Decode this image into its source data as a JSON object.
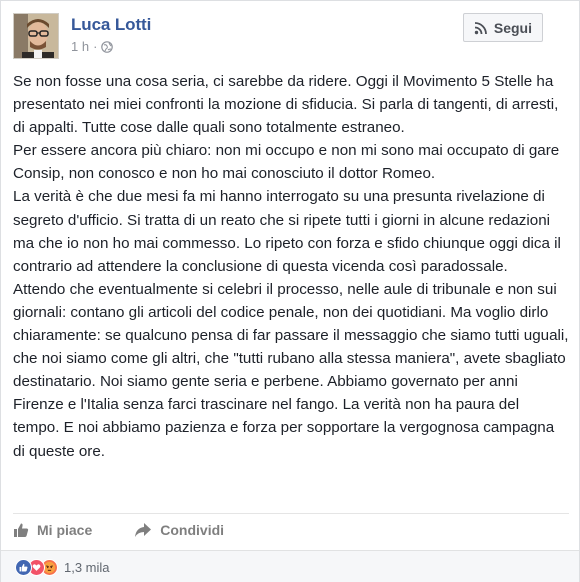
{
  "post": {
    "author": "Luca Lotti",
    "time": "1 h",
    "dot": "·",
    "follow_label": "Segui",
    "paragraphs": [
      "Se non fosse una cosa seria, ci sarebbe da ridere. Oggi il Movimento 5 Stelle ha presentato nei miei confronti la mozione di sfiducia. Si parla di tangenti, di arresti, di appalti. Tutte cose dalle quali sono totalmente estraneo.",
      "Per essere ancora più chiaro: non mi occupo e non mi sono mai occupato di gare Consip, non conosco e non ho mai conosciuto il dottor Romeo.",
      "La verità è che due mesi fa mi hanno interrogato su una presunta rivelazione di segreto d'ufficio. Si tratta di un reato che si ripete tutti i giorni in alcune redazioni ma che io non ho mai commesso. Lo ripeto con forza e sfido chiunque oggi dica il contrario ad attendere la conclusione di questa vicenda così paradossale.",
      "Attendo che eventualmente si celebri il processo, nelle aule di tribunale e non sui giornali: contano gli articoli del codice penale, non dei quotidiani. Ma voglio dirlo chiaramente: se qualcuno pensa di far passare il messaggio che siamo tutti uguali, che noi siamo come gli altri, che \"tutti rubano alla stessa maniera\", avete sbagliato destinatario. Noi siamo gente seria e perbene. Abbiamo governato per anni Firenze e l'Italia senza farci trascinare nel fango. La verità non ha paura del tempo. E noi abbiamo pazienza e forza per sopportare la vergognosa campagna di queste ore."
    ]
  },
  "actions": {
    "like_label": "Mi piace",
    "share_label": "Condividi"
  },
  "reactions": {
    "icons": [
      "like-icon",
      "love-icon",
      "angry-icon"
    ],
    "count": "1,3 mila"
  },
  "colors": {
    "author_link": "#365899",
    "meta_gray": "#90949c",
    "like_blue": "#4267b2",
    "love_red": "#f25268",
    "angry_orange": "#f7714c"
  }
}
